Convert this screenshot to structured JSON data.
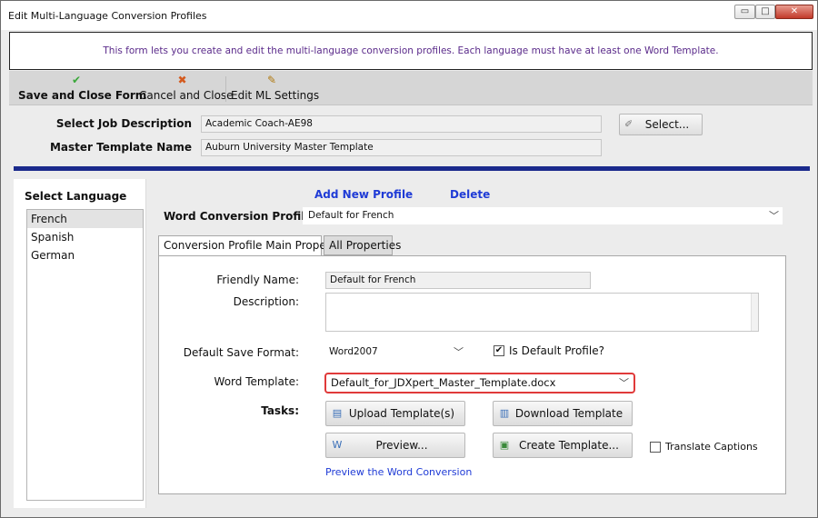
{
  "window": {
    "title": "Edit Multi-Language Conversion Profiles",
    "controls": {
      "minimize": "▭",
      "maximize": "□",
      "close": "✕"
    }
  },
  "banner": {
    "text": "This form lets you create and edit the multi-language conversion profiles. Each language must have at least one Word Template."
  },
  "toolbar": {
    "save": {
      "label": "Save and Close Form",
      "icon": "check-circle-icon",
      "glyph": "✔",
      "color": "#3aa83a"
    },
    "cancel": {
      "label": "Cancel and Close",
      "icon": "x-icon",
      "glyph": "✖",
      "color": "#d45a1e"
    },
    "settings": {
      "label": "Edit ML Settings",
      "icon": "settings-edit-icon",
      "glyph": "✎"
    }
  },
  "header_fields": {
    "job_label": "Select Job Description",
    "job_value": "Academic Coach-AE98",
    "master_label": "Master Template Name",
    "master_value": "Auburn University Master Template",
    "select_button": "Select...",
    "select_icon": "pen-icon"
  },
  "languages": {
    "header": "Select Language",
    "items": [
      "French",
      "Spanish",
      "German"
    ],
    "selected": "French"
  },
  "profile": {
    "add_link": "Add New Profile",
    "delete_link": "Delete",
    "label": "Word Conversion Profile:",
    "value": "Default for French"
  },
  "tabs": {
    "main": "Conversion Profile Main Properties",
    "all": "All Properties"
  },
  "form": {
    "friendly_label": "Friendly Name:",
    "friendly_value": "Default for French",
    "description_label": "Description:",
    "description_value": "",
    "save_format_label": "Default Save Format:",
    "save_format_value": "Word2007",
    "is_default_label": "Is Default Profile?",
    "is_default_checked": true,
    "word_template_label": "Word Template:",
    "word_template_value": "Default_for_JDXpert_Master_Template.docx",
    "tasks_label": "Tasks:",
    "upload_btn": "Upload Template(s)",
    "download_btn": "Download Template",
    "preview_btn": "Preview...",
    "create_btn": "Create Template...",
    "translate_label": "Translate Captions",
    "translate_checked": false,
    "preview_link": "Preview the Word Conversion"
  },
  "colors": {
    "accent_bar": "#1b2a8c",
    "link": "#1f3bd6",
    "highlight_border": "#e03a3a",
    "banner_text": "#5a2a8a"
  }
}
